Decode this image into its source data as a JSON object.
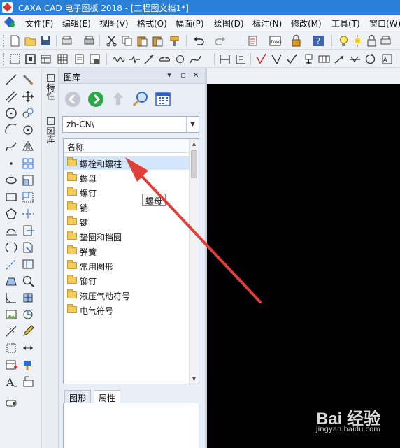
{
  "window": {
    "title": "CAXA CAD 电子图板 2018 - [工程图文档1*]"
  },
  "menu": [
    "文件(F)",
    "编辑(E)",
    "视图(V)",
    "格式(O)",
    "幅面(P)",
    "绘图(D)",
    "标注(N)",
    "修改(M)",
    "工具(T)",
    "窗口(W)"
  ],
  "side_tabs": {
    "properties": "特性",
    "library": "图库"
  },
  "panel": {
    "title": "图库",
    "path": "zh-CN\\",
    "list_header": "名称",
    "items": [
      "螺栓和螺柱",
      "螺母",
      "螺钉",
      "销",
      "键",
      "垫圈和挡圈",
      "弹簧",
      "常用图形",
      "铆钉",
      "液压气动符号",
      "电气符号"
    ],
    "selected_index": 0,
    "tooltip": "螺母",
    "bottom_tabs": [
      "图形",
      "属性"
    ],
    "active_bottom_tab": 1
  },
  "colors": {
    "titlebar": "#2a7fd6",
    "annotation_arrow": "#e0403a",
    "canvas": "#000000"
  },
  "watermark": {
    "brand": "Bai 经验",
    "url": "jingyan.baidu.com"
  }
}
